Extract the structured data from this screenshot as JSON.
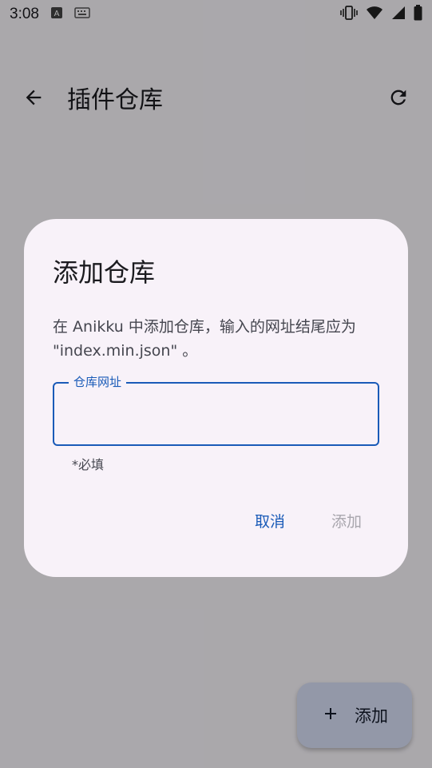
{
  "status_bar": {
    "time": "3:08",
    "icons": [
      "keyboard-a-icon",
      "keyboard-icon",
      "vibrate-icon",
      "wifi-icon",
      "signal-icon",
      "battery-icon"
    ]
  },
  "app_bar": {
    "title": "插件仓库"
  },
  "fab": {
    "label": "添加"
  },
  "dialog": {
    "title": "添加仓库",
    "message": "在 Anikku 中添加仓库，输入的网址结尾应为 \"index.min.json\" 。",
    "field_label": "仓库网址",
    "field_value": "",
    "supporting_text": "*必填",
    "cancel_label": "取消",
    "add_label": "添加"
  },
  "colors": {
    "accent": "#1a5bb8",
    "dialog_bg": "#f8f2f9",
    "disabled": "#a8a6ad",
    "fab_bg": "#d9e0f8"
  }
}
